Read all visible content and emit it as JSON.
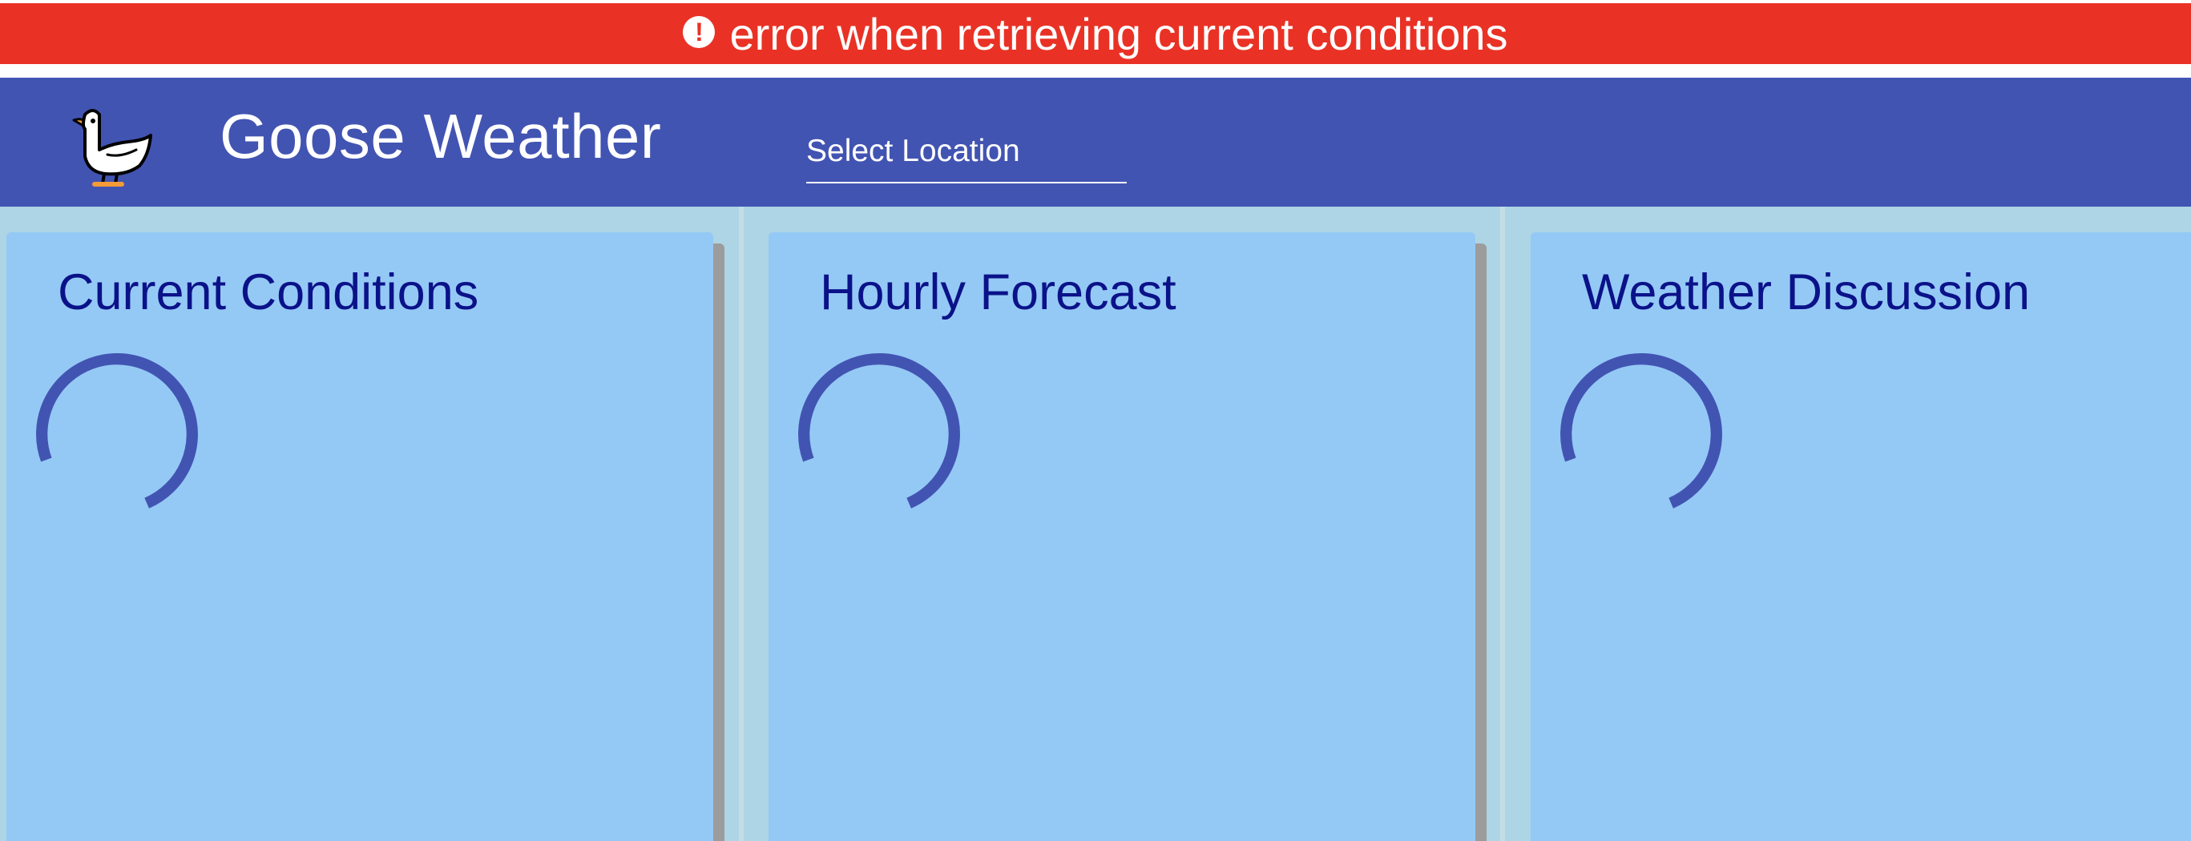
{
  "error_banner": {
    "icon": "exclamation-circle-icon",
    "message": "error when retrieving current conditions",
    "color": "#e93225"
  },
  "header": {
    "logo_icon": "goose-icon",
    "title": "Goose Weather",
    "location_select_placeholder": "Select Location",
    "color": "#4254b2"
  },
  "cards": [
    {
      "title": "Current Conditions",
      "loading": true
    },
    {
      "title": "Hourly Forecast",
      "loading": true
    },
    {
      "title": "Weather Discussion",
      "loading": true
    }
  ],
  "colors": {
    "background": "#add5e6",
    "card": "#94c9f5",
    "card_title": "#0b1289",
    "spinner": "#4254b2"
  }
}
